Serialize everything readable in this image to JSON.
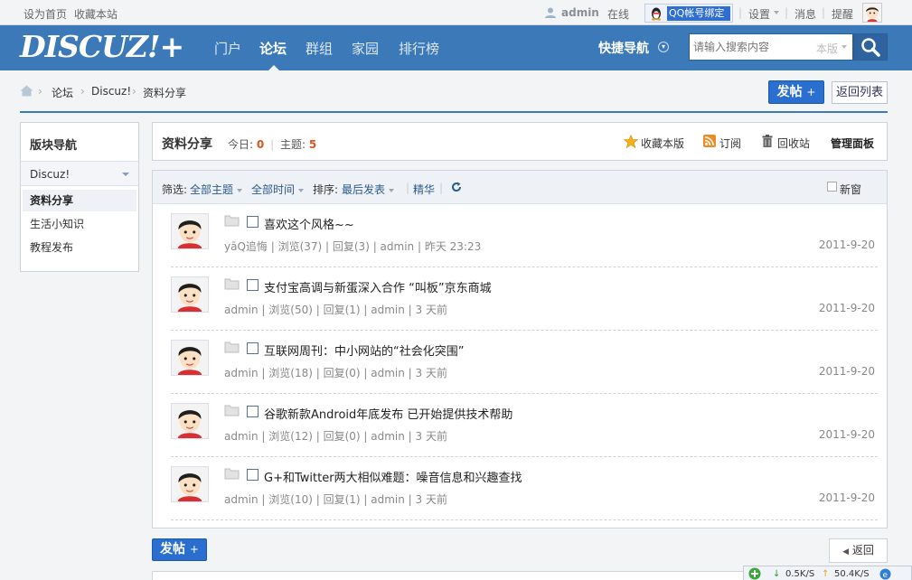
{
  "topbar": {
    "set_home": "设为首页",
    "bookmark_site": "收藏本站",
    "username": "admin",
    "online": "在线",
    "qq_bind": "QQ帐号绑定",
    "settings": "设置",
    "messages": "消息",
    "reminders": "提醒"
  },
  "header": {
    "logo": "DISCUZ!+",
    "nav": [
      "门户",
      "论坛",
      "群组",
      "家园",
      "排行榜"
    ],
    "active_nav": "论坛",
    "quick_nav": "快捷导航",
    "search_placeholder": "请输入搜索内容",
    "search_scope": "本版"
  },
  "breadcrumb": [
    "论坛",
    "Discuz!",
    "资料分享"
  ],
  "actions": {
    "post": "发帖",
    "back_to_list": "返回列表",
    "return": "返回"
  },
  "sidebar": {
    "title": "版块导航",
    "group": "Discuz!",
    "items": [
      "资料分享",
      "生活小知识",
      "教程发布"
    ],
    "active_item": "资料分享"
  },
  "forum": {
    "name": "资料分享",
    "today_label": "今日:",
    "today_count": "0",
    "threads_label": "主题:",
    "threads_count": "5",
    "favorite": "收藏本版",
    "subscribe": "订阅",
    "recycle": "回收站",
    "manage": "管理面板"
  },
  "filters": {
    "label": "筛选:",
    "all_threads": "全部主题",
    "all_time": "全部时间",
    "sort_label": "排序:",
    "sort_value": "最后发表",
    "digest": "精华",
    "new_window": "新窗"
  },
  "threads": [
    {
      "title": "喜欢这个风格~~",
      "meta": "yāQ追悔 | 浏览(37) | 回复(3) | admin | 昨天 23:23",
      "date": "2011-9-20"
    },
    {
      "title": "支付宝高调与新蛋深入合作 “叫板”京东商城",
      "meta": "admin | 浏览(50) | 回复(1) | admin | 3 天前",
      "date": "2011-9-20"
    },
    {
      "title": "互联网周刊：中小网站的“社会化突围”",
      "meta": "admin | 浏览(18) | 回复(0) | admin | 3 天前",
      "date": "2011-9-20"
    },
    {
      "title": "谷歌新款Android年底发布 已开始提供技术帮助",
      "meta": "admin | 浏览(12) | 回复(0) | admin | 3 天前",
      "date": "2011-9-20"
    },
    {
      "title": "G+和Twitter两大相似难题：噪音信息和兴趣查找",
      "meta": "admin | 浏览(10) | 回复(1) | admin | 3 天前",
      "date": "2011-9-20"
    }
  ],
  "netspeed": {
    "down": "0.5K/S",
    "up": "50.4K/S"
  },
  "colors": {
    "header_blue": "#3b79b8",
    "button_blue": "#2a6fd0",
    "count_orange": "#e0531a"
  }
}
